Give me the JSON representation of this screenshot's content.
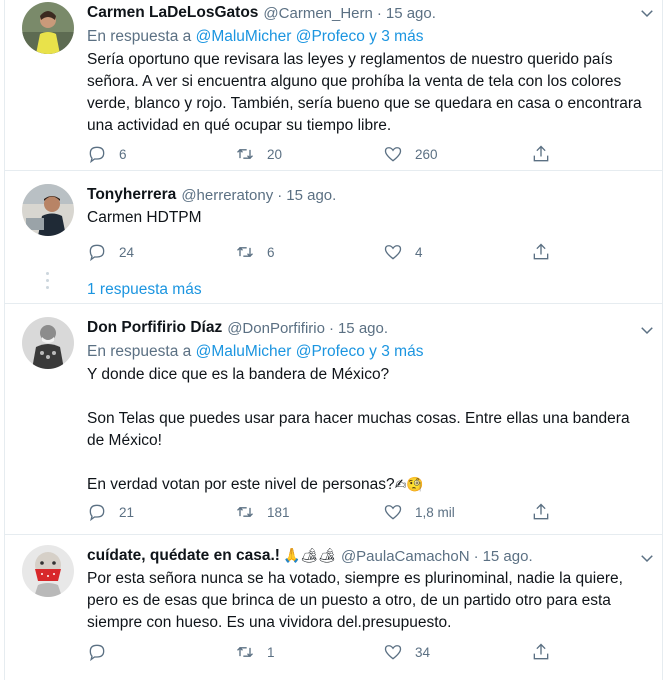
{
  "tweets": [
    {
      "name": "Carmen LaDeLosGatos",
      "handle": "@Carmen_Hern",
      "dot": "·",
      "time": "15 ago.",
      "reply_prefix": "En respuesta a",
      "reply_mentions": "@MaluMicher @Profeco y 3 más",
      "text": "Sería oportuno que revisara las leyes y reglamentos de nuestro querido país señora. A ver si encuentra alguno que prohíba la venta de tela con los colores verde, blanco y rojo. También, sería bueno que se quedara en casa o encontrara una actividad en qué ocupar su tiempo libre.",
      "replies": "6",
      "retweets": "20",
      "likes": "260"
    },
    {
      "name": "Tonyherrera",
      "handle": "@herreratony",
      "dot": "·",
      "time": "15 ago.",
      "text": "Carmen HDTPM",
      "replies": "24",
      "retweets": "6",
      "likes": "4"
    },
    {
      "name": "Don Porfifirio Díaz",
      "handle": "@DonPorfifirio",
      "dot": "·",
      "time": "15 ago.",
      "reply_prefix": "En respuesta a",
      "reply_mentions": "@MaluMicher @Profeco y 3 más",
      "text": "Y donde dice que es la bandera de México?\n\nSon Telas que puedes usar para hacer muchas cosas. Entre ellas una bandera de México!\n\nEn verdad votan por este nivel de personas?",
      "text_emoji": "✍🧐",
      "replies": "21",
      "retweets": "181",
      "likes": "1,8 mil"
    },
    {
      "name": "cuídate, quédate en casa.!",
      "name_emoji": "🙏🏕🏕",
      "handle": "@PaulaCamachoN",
      "dot": "·",
      "time": "15 ago.",
      "text": "Por esta señora nunca se ha votado, siempre es plurinominal, nadie la quiere, pero es de esas que brinca de un puesto a otro, de un partido otro para esta siempre con hueso. Es una vividora del.presupuesto.",
      "replies": "",
      "retweets": "1",
      "likes": "34"
    }
  ],
  "more_replies": "1 respuesta más",
  "colors": {
    "accent": "#1b95e0",
    "secondary_text": "#5b7083",
    "border": "#e6ecf0"
  },
  "icons": [
    "reply-icon",
    "retweet-icon",
    "like-icon",
    "share-icon",
    "chevron-down-icon"
  ]
}
